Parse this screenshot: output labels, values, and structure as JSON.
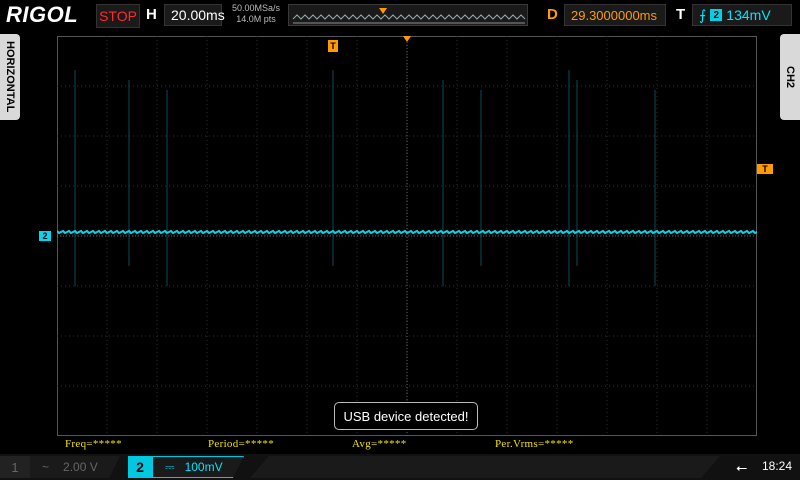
{
  "header": {
    "logo": "RIGOL",
    "run_state": "STOP",
    "horizontal_label": "H",
    "timebase": "20.00ms",
    "sample_rate": "50.00MSa/s",
    "memory_depth": "14.0M pts",
    "delay_label": "D",
    "delay": "29.3000000ms",
    "trigger_label": "T",
    "trigger_edge_icon": "rising-edge-icon",
    "trigger_channel": "2",
    "trigger_level": "134mV"
  },
  "side_tabs": {
    "left": "HORIZONTAL",
    "right": "CH2"
  },
  "markers": {
    "ch2_ref": "2",
    "trigger_level_marker": "T",
    "trigger_position_marker": "T"
  },
  "toast": "USB device detected!",
  "measurements": {
    "freq": "Freq=*****",
    "period": "Period=*****",
    "avg": "Avg=*****",
    "vrms": "Per.Vrms=*****"
  },
  "channels": {
    "ch1": {
      "number": "1",
      "coupling_icon": "ac-coupling-icon",
      "coupling": "~",
      "scale": "2.00 V"
    },
    "ch2": {
      "number": "2",
      "coupling_icon": "dc-coupling-icon",
      "coupling": "⎓",
      "scale": "100mV"
    }
  },
  "status": {
    "usb_icon": "usb-icon",
    "usb_glyph": "⭠",
    "time": "18:24"
  },
  "colors": {
    "ch2": "#00d8f0",
    "trigger": "#ff9a00",
    "stop": "#ff2a2a",
    "measure": "#f0e000"
  }
}
